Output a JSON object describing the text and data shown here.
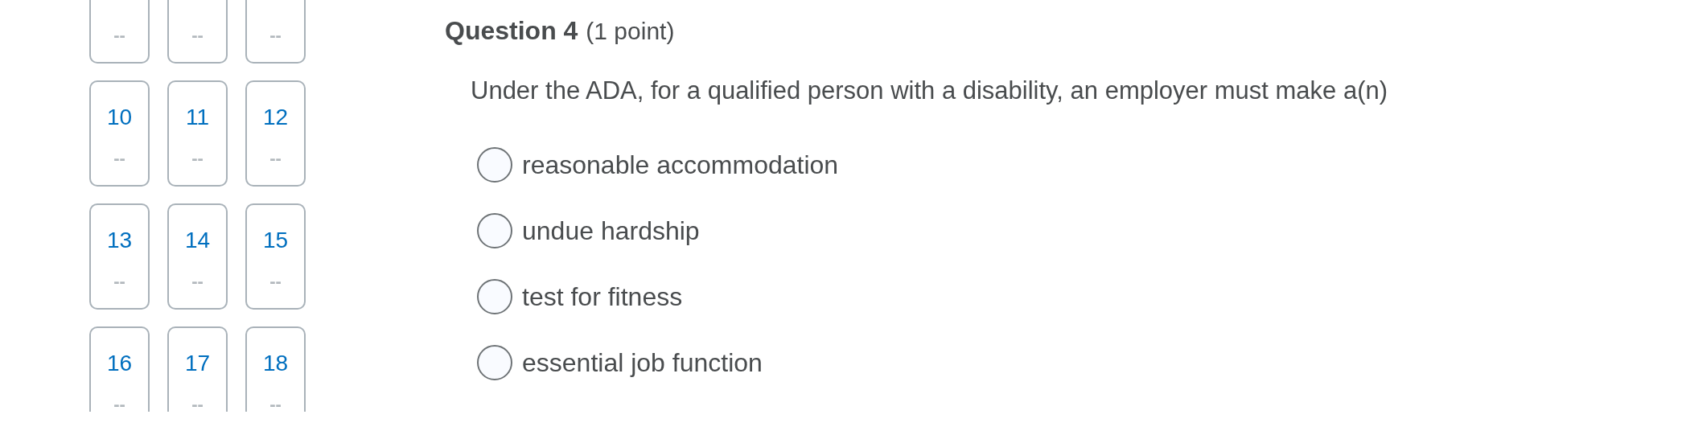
{
  "question_nav": [
    {
      "status": "--"
    },
    {
      "status": "--"
    },
    {
      "status": "--"
    },
    {
      "number": "10",
      "status": "--"
    },
    {
      "number": "11",
      "status": "--"
    },
    {
      "number": "12",
      "status": "--"
    },
    {
      "number": "13",
      "status": "--"
    },
    {
      "number": "14",
      "status": "--"
    },
    {
      "number": "15",
      "status": "--"
    },
    {
      "number": "16",
      "status": "--"
    },
    {
      "number": "17",
      "status": "--"
    },
    {
      "number": "18",
      "status": "--"
    }
  ],
  "question": {
    "title": "Question 4",
    "points": "(1 point)",
    "prompt": "Under the ADA, for a qualified person with a disability, an employer must make a(n)",
    "options": [
      {
        "label": "reasonable accommodation",
        "selected": false
      },
      {
        "label": "undue hardship",
        "selected": false
      },
      {
        "label": "test for fitness",
        "selected": false
      },
      {
        "label": "essential job function",
        "selected": false
      }
    ]
  }
}
